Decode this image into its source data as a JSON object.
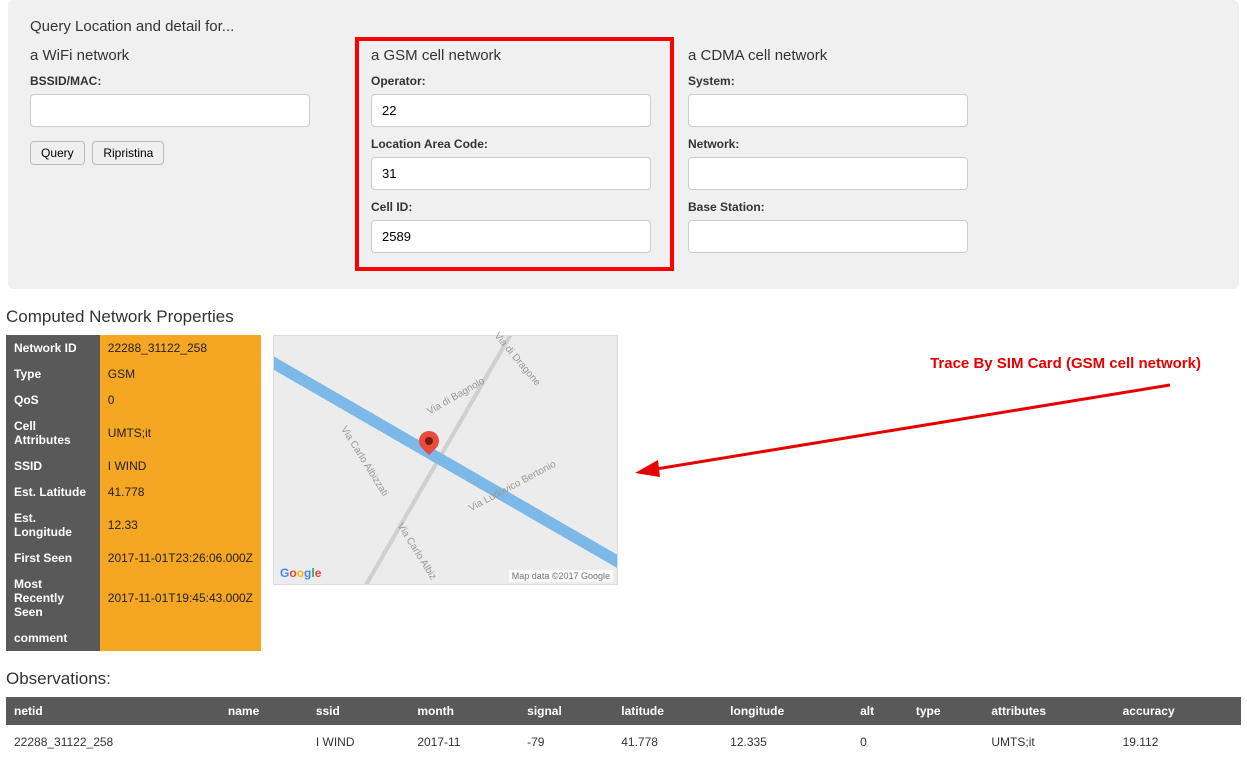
{
  "panel": {
    "title": "Query Location and detail for...",
    "wifi": {
      "heading": "a WiFi network",
      "bssid_label": "BSSID/MAC:",
      "bssid_value": ""
    },
    "gsm": {
      "heading": "a GSM cell network",
      "operator_label": "Operator:",
      "operator_value": "22",
      "lac_label": "Location Area Code:",
      "lac_value": "31",
      "cellid_label": "Cell ID:",
      "cellid_value": "2589"
    },
    "cdma": {
      "heading": "a CDMA cell network",
      "system_label": "System:",
      "system_value": "",
      "network_label": "Network:",
      "network_value": "",
      "base_label": "Base Station:",
      "base_value": ""
    },
    "query_btn": "Query",
    "reset_btn": "Ripristina"
  },
  "properties": {
    "section_title": "Computed Network Properties",
    "rows": {
      "network_id_label": "Network ID",
      "network_id_value": "22288_31122_258",
      "type_label": "Type",
      "type_value": "GSM",
      "qos_label": "QoS",
      "qos_value": "0",
      "cell_attr_label": "Cell Attributes",
      "cell_attr_value": "UMTS;it",
      "ssid_label": "SSID",
      "ssid_value": "I WIND",
      "lat_label": "Est. Latitude",
      "lat_value": "41.778",
      "lon_label": "Est. Longitude",
      "lon_value": "12.33",
      "first_seen_label": "First Seen",
      "first_seen_value": "2017-11-01T23:26:06.000Z",
      "most_recent_label": "Most Recently Seen",
      "most_recent_value": "2017-11-01T19:45:43.000Z",
      "comment_label": "comment",
      "comment_value": ""
    }
  },
  "map": {
    "streets": [
      "Via di Dragone",
      "Via di Bagnolo",
      "Via Ludovico Bertonio",
      "Via Carlo Albizzati",
      "Via Carlo Albiz"
    ],
    "attribution": "Map data ©2017 Google"
  },
  "annotation": {
    "text": "Trace By SIM Card (GSM cell network)"
  },
  "observations": {
    "title": "Observations:",
    "headers": {
      "netid": "netid",
      "name": "name",
      "ssid": "ssid",
      "month": "month",
      "signal": "signal",
      "latitude": "latitude",
      "longitude": "longitude",
      "alt": "alt",
      "type": "type",
      "attributes": "attributes",
      "accuracy": "accuracy"
    },
    "row": {
      "netid": "22288_31122_258",
      "name": "",
      "ssid": "I WIND",
      "month": "2017-11",
      "signal": "-79",
      "latitude": "41.778",
      "longitude": "12.335",
      "alt": "0",
      "type": "",
      "attributes": "UMTS;it",
      "accuracy": "19.112"
    }
  }
}
